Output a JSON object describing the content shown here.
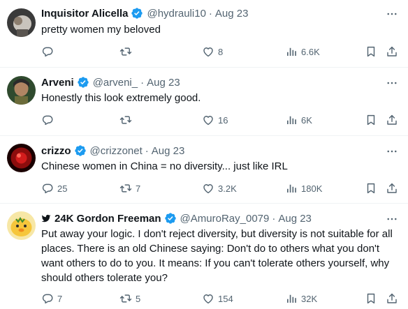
{
  "colors": {
    "verified": "#1d9bf0",
    "muted": "#536471",
    "text": "#0f1419",
    "divider": "#eff3f4"
  },
  "tweets": [
    {
      "name": "Inquisitor Alicella",
      "handle": "@hydrauli10",
      "sep": "·",
      "date": "Aug 23",
      "text": "pretty women my beloved",
      "stats": {
        "replies": "",
        "retweets": "",
        "likes": "8",
        "views": "6.6K"
      }
    },
    {
      "name": "Arveni",
      "handle": "@arveni_",
      "sep": "·",
      "date": "Aug 23",
      "text": "Honestly this look extremely good.",
      "stats": {
        "replies": "",
        "retweets": "",
        "likes": "16",
        "views": "6K"
      }
    },
    {
      "name": "crizzo",
      "handle": "@crizzonet",
      "sep": "·",
      "date": "Aug 23",
      "text": "Chinese women in China = no diversity... just like IRL",
      "stats": {
        "replies": "25",
        "retweets": "7",
        "likes": "3.2K",
        "views": "180K"
      }
    },
    {
      "name": "24K Gordon Freeman",
      "handle": "@AmuroRay_0079",
      "sep": "·",
      "date": "Aug 23",
      "text": "Put away your logic. I don't reject diversity, but diversity is not suitable for all places. There is an old Chinese saying: Don't do to others what you don't want others to do to you. It means: If you can't tolerate others yourself, why should others tolerate you?",
      "stats": {
        "replies": "7",
        "retweets": "5",
        "likes": "154",
        "views": "32K"
      }
    }
  ],
  "icons": {
    "verified": "verified-badge-icon",
    "more": "more-icon",
    "reply": "reply-icon",
    "retweet": "retweet-icon",
    "like": "heart-icon",
    "views": "views-icon",
    "bookmark": "bookmark-icon",
    "share": "share-icon",
    "bot": "bird-icon"
  }
}
